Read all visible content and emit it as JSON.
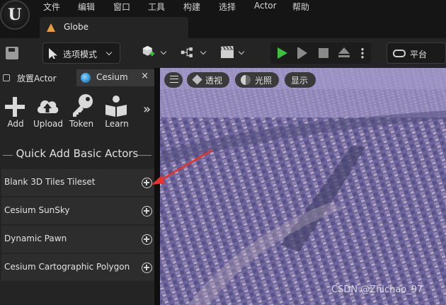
{
  "menubar": {
    "logo_text": "U",
    "items": [
      "文件",
      "编辑",
      "窗口",
      "工具",
      "构建",
      "选择",
      "Actor",
      "帮助"
    ]
  },
  "document_tab": {
    "label": "Globe"
  },
  "toolbar": {
    "mode_label": "选项模式",
    "platform_label": "平台"
  },
  "panel": {
    "tabs": [
      {
        "label": "放置Actor"
      },
      {
        "label": "Cesium",
        "close": "×"
      }
    ],
    "cesium_buttons": [
      {
        "label": "Add",
        "icon": "plus-icon"
      },
      {
        "label": "Upload",
        "icon": "cloud-upload-icon"
      },
      {
        "label": "Token",
        "icon": "key-icon"
      },
      {
        "label": "Learn",
        "icon": "book-reader-icon"
      }
    ],
    "more_glyph": "»",
    "quick_add_title": "Quick Add Basic Actors",
    "actors": [
      {
        "label": "Blank 3D Tiles Tileset"
      },
      {
        "label": "Cesium SunSky"
      },
      {
        "label": "Dynamic Pawn"
      },
      {
        "label": "Cesium Cartographic Polygon"
      }
    ]
  },
  "viewport": {
    "perspective_label": "透视",
    "lighting_label": "光照",
    "show_label": "显示",
    "watermark": "CSDN @Zhichao_97"
  },
  "colors": {
    "accent_orange": "#e99e39",
    "play_green": "#3fbf3f",
    "annotation_red": "#e8322a"
  }
}
